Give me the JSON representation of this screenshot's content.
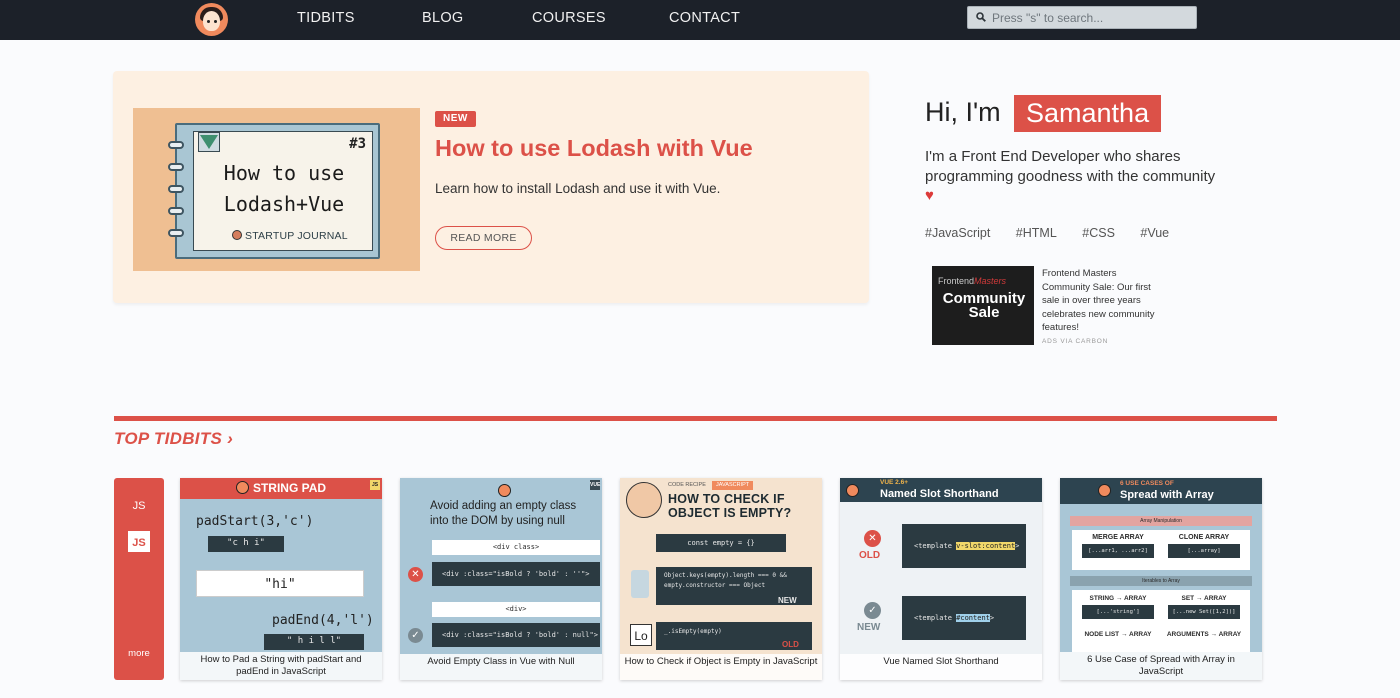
{
  "nav": {
    "links": [
      "TIDBITS",
      "BLOG",
      "COURSES",
      "CONTACT"
    ],
    "search_placeholder": "Press \"s\" to search..."
  },
  "feature": {
    "cover": {
      "issue": "#3",
      "title": "How to use Lodash+Vue",
      "journal": "STARTUP JOURNAL"
    },
    "badge": "NEW",
    "title": "How to use Lodash with Vue",
    "description": "Learn how to install Lodash and use it with Vue.",
    "read_more": "READ MORE"
  },
  "profile": {
    "greeting": "Hi, I'm",
    "name": "Samantha",
    "bio": "I'm a Front End Developer who shares programming goodness with the community",
    "heart": "♥",
    "tags": [
      "#JavaScript",
      "#HTML",
      "#CSS",
      "#Vue"
    ]
  },
  "ad": {
    "brand_a": "Frontend",
    "brand_b": "Masters",
    "headline": "Community Sale",
    "text": "Frontend Masters Community Sale: Our first sale in over three years celebrates new community features!",
    "via": "ADS VIA CARBON"
  },
  "tidbits": {
    "heading": "TOP TIDBITS ›",
    "category_label": "JS",
    "category_box": "JS",
    "more": "more",
    "cards": [
      {
        "header": "STRING PAD",
        "corner": "JS",
        "code_start": "padStart(3,'c')",
        "chars_start": "\"c  h  i\"",
        "value": "\"hi\"",
        "code_end": "padEnd(4,'l')",
        "chars_end": "\"  h  i  l  l\"",
        "caption": "How to Pad a String with padStart and padEnd in JavaScript"
      },
      {
        "header": "Avoid adding an empty class into the DOM by using null",
        "corner": "VUE",
        "tag_div_class": "<div class>",
        "code_bad": "<div :class=\"isBold ? 'bold' : ''\">",
        "tag_div": "<div>",
        "code_good": "<div :class=\"isBold ? 'bold' : null\">",
        "caption": "Avoid Empty Class in Vue with Null"
      },
      {
        "kicker": "CODE RECIPE",
        "pill": "JAVASCRIPT",
        "header": "HOW TO CHECK IF OBJECT IS EMPTY?",
        "code_1": "const empty = {}",
        "code_2": "Object.keys(empty).length === 0 && empty.constructor === Object",
        "code_3": "_.isEmpty(empty)",
        "new_label": "NEW",
        "old_label": "OLD",
        "lodash": "Lo",
        "caption": "How to Check if Object is Empty in JavaScript"
      },
      {
        "kicker": "VUE 2.6+",
        "header": "Named Slot Shorthand",
        "old_label": "OLD",
        "new_label": "NEW",
        "code_old_a": "<template ",
        "code_old_b": "v-slot:content",
        "code_new_a": "<template ",
        "code_new_b": "#content",
        "caption": "Vue Named Slot Shorthand"
      },
      {
        "kicker": "6 USE CASES OF",
        "header": "Spread with Array",
        "group_1": "Array Manipulation",
        "merge": "MERGE ARRAY",
        "merge_code": "[...arr1, ...arr2]",
        "clone": "CLONE ARRAY",
        "clone_code": "[...array]",
        "group_2": "Iterables to Array",
        "string": "STRING → ARRAY",
        "string_code": "[...'string']",
        "set": "SET → ARRAY",
        "set_code": "[...new Set([1,2])]",
        "nodelist": "NODE LIST → ARRAY",
        "args": "ARGUMENTS → ARRAY",
        "caption": "6 Use Case of Spread with Array in JavaScript"
      }
    ]
  },
  "colors": {
    "accent": "#dc5148",
    "nav_bg": "#1c2129",
    "feature_bg": "#fdf0e2"
  }
}
